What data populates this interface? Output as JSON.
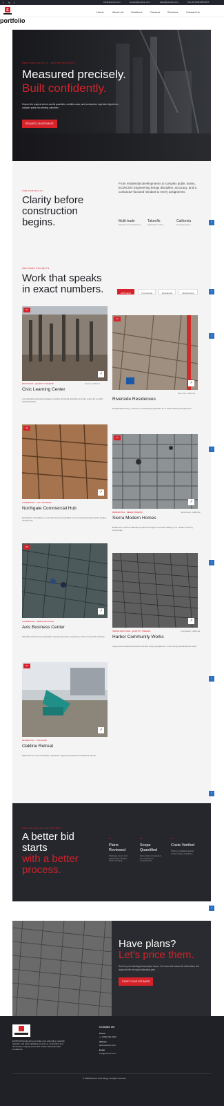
{
  "topbar": {
    "social": [
      "f",
      "in",
      "t"
    ],
    "contacts": [
      "info@ecwcon.com",
      "support@ecwcon.com",
      "sales@ecwcon.com",
      "Mon-Fri 8AM-6PM EST"
    ]
  },
  "nav": {
    "items": [
      "Home",
      "About Us",
      "Solutions",
      "Careers",
      "Services",
      "Contact Us"
    ]
  },
  "page_label": "portfolio",
  "hero": {
    "eyebrow": "Measured results · Proven projects",
    "title_line1": "Measured precisely.",
    "title_line2": "Built confidently.",
    "desc": "Explore the projects where careful quantities, credible costs, and construction expertise helped turn complex plans into winning outcomes.",
    "button": "REQUEST AN ESTIMATE"
  },
  "clarity": {
    "eyebrow": "Our portfolio",
    "title_line1": "Clarity before",
    "title_line2": "construction",
    "title_line3": "begins.",
    "text": "From residential developments to complex public works, ECWCON Engineering brings discipline, accuracy, and a contractor-focused mindset to every assignment.",
    "stats": [
      {
        "value": "Multi-trade",
        "label": "Estimates across all divisions"
      },
      {
        "value": "Takeoffs",
        "label": "Detailed and verified"
      },
      {
        "value": "California",
        "label": "Serving all regions"
      }
    ]
  },
  "work": {
    "eyebrow": "Featured projects",
    "title_line1": "Work that speaks",
    "title_line2": "in exact numbers.",
    "tabs": [
      "All Projects",
      "Commercial",
      "Residential",
      "Infrastructure"
    ]
  },
  "projects": [
    {
      "badge": "01",
      "category": "Education · Quantity takeoff",
      "location": "Fresno, California",
      "title": "Civic Learning Center",
      "desc": "A coordinated estimate package covering structural quantities and site scope for a public learning facility."
    },
    {
      "badge": "02",
      "category": "Residential · Cost estimate",
      "location": "San Jose, California",
      "title": "Riverside Residences",
      "desc": "Residential framing, concrete, and finishing quantities for a multi-building development."
    },
    {
      "badge": "03",
      "category": "Commercial · Full estimate",
      "location": "Oakland, California",
      "title": "Northgate Commercial Hub",
      "desc": "Excavation, foundations, and reinforcement quantities for a commercial project with complex sequencing."
    },
    {
      "badge": "04",
      "category": "Residential · Rebar takeoff",
      "location": "Sacramento, California",
      "title": "Sierra Modern Homes",
      "desc": "Rebar and concrete takeoffs prepared to support accurate bidding on a modern housing community."
    },
    {
      "badge": "05",
      "category": "Commercial · Rebar detailing",
      "location": "Irvine, California",
      "title": "Axis Business Center",
      "desc": "Mat slab reinforcement quantities and pricing inputs supporting a fast-moving bid schedule."
    },
    {
      "badge": "06",
      "category": "Infrastructure · Quantity takeoff",
      "location": "Long Beach, California",
      "title": "Harbor Community Works",
      "desc": "Large-area reinforcement and concrete scope prepared for a community infrastructure build."
    },
    {
      "badge": "07",
      "category": "Residential · Site work",
      "location": "Walnut Creek, California",
      "title": "Oakline Retreat",
      "desc": "Earthwork and site preparation quantities supporting a phased residential retreat."
    }
  ],
  "process": {
    "eyebrow": "How we deliver better bids",
    "title_line1": "A better bid",
    "title_line2": "starts",
    "title_line3": "with a better",
    "title_line4": "process.",
    "steps": [
      {
        "num": "01",
        "title": "Plans Reviewed",
        "desc": "Drawings, specs, and addenda are studied before counting."
      },
      {
        "num": "02",
        "title": "Scope Quantified",
        "desc": "Every trade is measured and checked for completeness."
      },
      {
        "num": "03",
        "title": "Costs Verified",
        "desc": "Pricing is validated against current market conditions."
      }
    ]
  },
  "cta": {
    "title_line1": "Have plans?",
    "title_line2": "Let's price them.",
    "desc": "Send us your drawings and project scope. Our team will review the information and respond with the right estimating path.",
    "button": "START YOUR ESTIMATE"
  },
  "footer": {
    "about": "ECWCON Engineering provides cost estimating, quantity takeoffs, and rebar detailing services to contractors and developers, helping teams bid smarter and build with confidence.",
    "contact_heading": "Contact Us",
    "phone_label": "Phone",
    "phone": "+1 (000) 000-0000",
    "web_label": "Website",
    "web": "www.ecwcon.com",
    "email_label": "Email",
    "email": "info@ecwcon.com",
    "copyright": "© 2025 Ecwcon Technology. All rights reserved."
  },
  "colors": {
    "accent": "#d6222a",
    "dark": "#26272d",
    "footer": "#1f2127",
    "scroll_button": "#2c6fbe"
  },
  "icons": [
    "facebook-icon",
    "linkedin-icon",
    "twitter-icon",
    "arrow-up-right-icon",
    "arrow-up-icon"
  ]
}
